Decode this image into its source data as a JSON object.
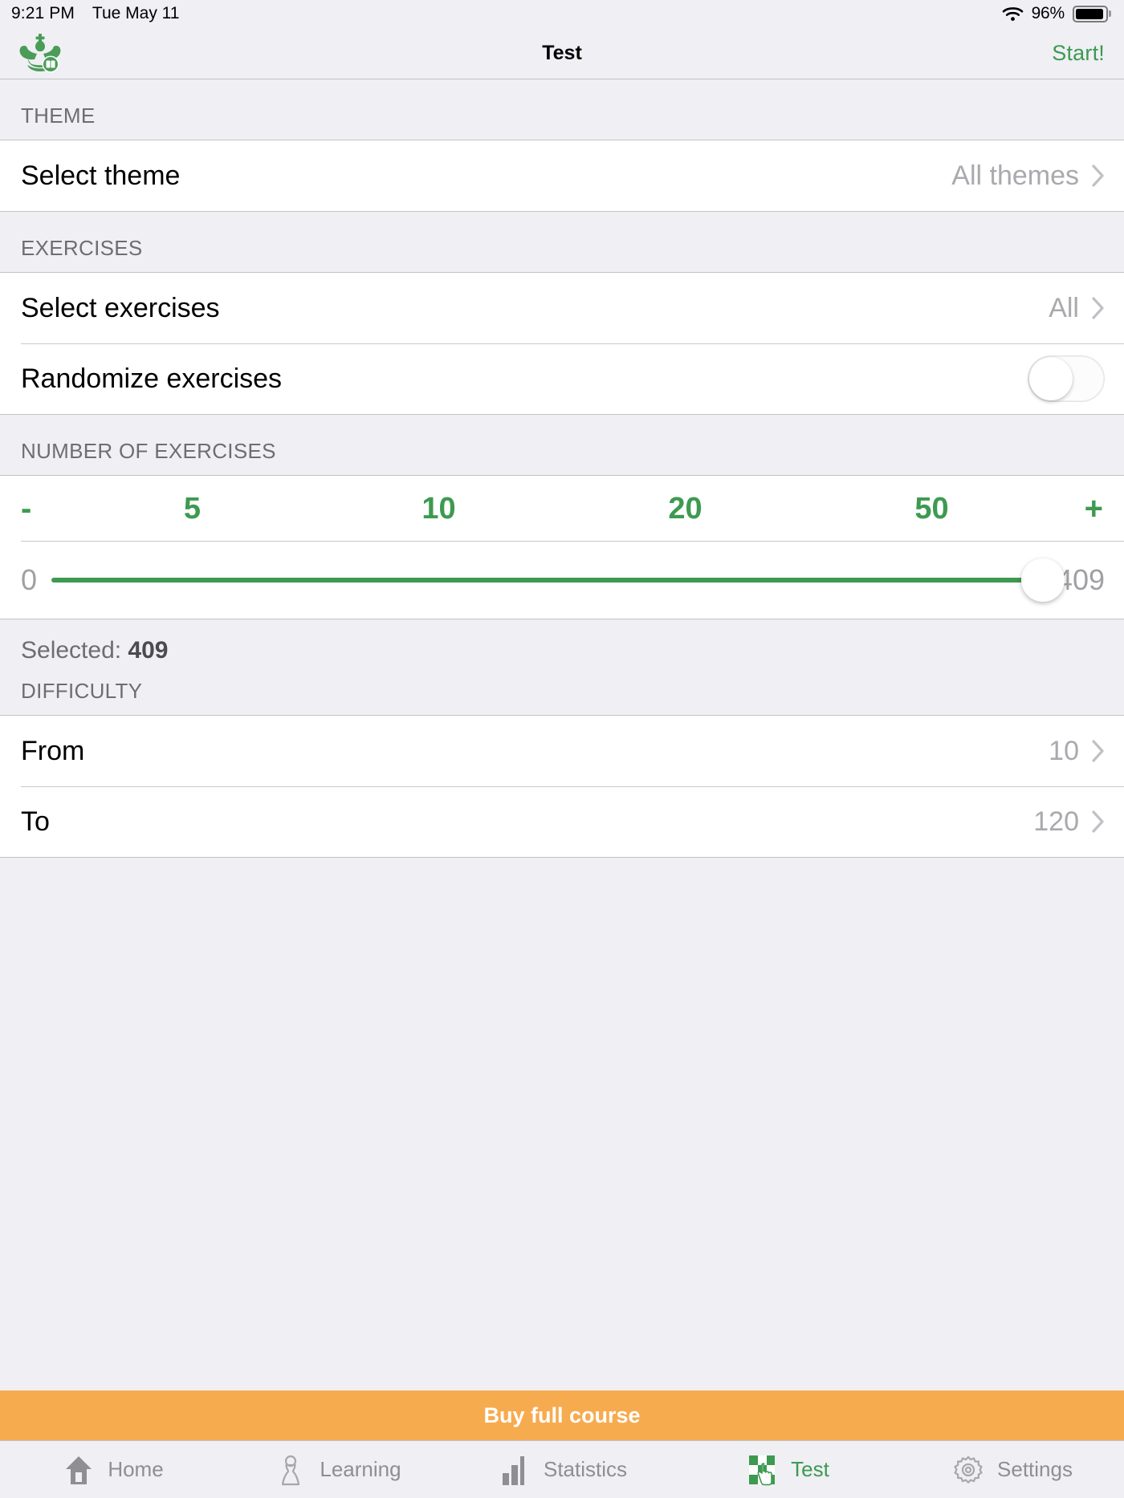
{
  "status_bar": {
    "time": "9:21 PM",
    "date": "Tue May 11",
    "battery_percent": "96%",
    "wifi_icon": "wifi-icon",
    "battery_icon": "battery-icon"
  },
  "nav": {
    "logo_icon": "chess-king-book-logo",
    "title": "Test",
    "start_label": "Start!"
  },
  "sections": {
    "theme": {
      "header": "THEME",
      "row": {
        "label": "Select theme",
        "value": "All themes"
      }
    },
    "exercises": {
      "header": "EXERCISES",
      "select": {
        "label": "Select exercises",
        "value": "All"
      },
      "randomize": {
        "label": "Randomize exercises",
        "state": "off"
      }
    },
    "number_of_exercises": {
      "header": "NUMBER OF EXERCISES",
      "quick_picks": [
        "-",
        "5",
        "10",
        "20",
        "50",
        "+"
      ],
      "slider": {
        "min": "0",
        "max": "409",
        "value": 409
      },
      "selected_prefix": "Selected: ",
      "selected_value": "409"
    },
    "difficulty": {
      "header": "DIFFICULTY",
      "from": {
        "label": "From",
        "value": "10"
      },
      "to": {
        "label": "To",
        "value": "120"
      }
    }
  },
  "buy_banner": {
    "label": "Buy full course"
  },
  "tabbar": {
    "items": [
      {
        "label": "Home",
        "icon": "home-icon",
        "active": false
      },
      {
        "label": "Learning",
        "icon": "pawn-icon",
        "active": false
      },
      {
        "label": "Statistics",
        "icon": "bar-chart-icon",
        "active": false
      },
      {
        "label": "Test",
        "icon": "checkerboard-hand-icon",
        "active": true
      },
      {
        "label": "Settings",
        "icon": "gear-icon",
        "active": false
      }
    ]
  },
  "colors": {
    "accent_green": "#3d9a50",
    "banner_orange": "#f7ab4f",
    "group_bg": "#efeff4",
    "muted_text": "#a9a9ae"
  }
}
